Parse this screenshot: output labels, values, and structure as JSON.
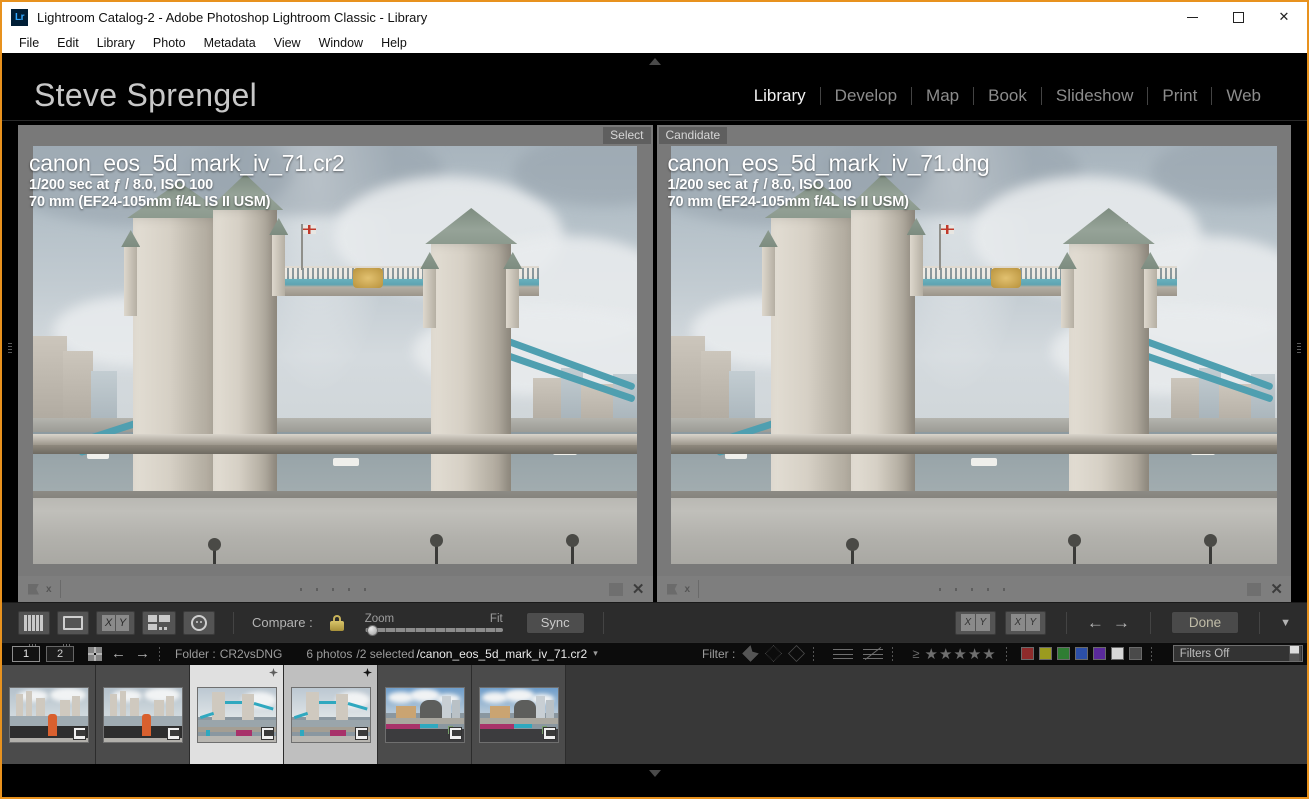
{
  "window": {
    "title": "Lightroom Catalog-2 - Adobe Photoshop Lightroom Classic - Library",
    "logo_text": "Lr",
    "minimize": "—",
    "maximize": "□",
    "close": "✕"
  },
  "menubar": {
    "items": [
      "File",
      "Edit",
      "Library",
      "Photo",
      "Metadata",
      "View",
      "Window",
      "Help"
    ]
  },
  "identity": {
    "name": "Steve Sprengel"
  },
  "modules": [
    {
      "label": "Library",
      "active": true
    },
    {
      "label": "Develop",
      "active": false
    },
    {
      "label": "Map",
      "active": false
    },
    {
      "label": "Book",
      "active": false
    },
    {
      "label": "Slideshow",
      "active": false
    },
    {
      "label": "Print",
      "active": false
    },
    {
      "label": "Web",
      "active": false
    }
  ],
  "compare": {
    "select": {
      "badge": "Select",
      "filename": "canon_eos_5d_mark_iv_71.cr2",
      "exposure": "1/200 sec at ƒ / 8.0, ISO 100",
      "lens": "70 mm (EF24-105mm f/4L IS II USM)"
    },
    "candidate": {
      "badge": "Candidate",
      "filename": "canon_eos_5d_mark_iv_71.dng",
      "exposure": "1/200 sec at ƒ / 8.0, ISO 100",
      "lens": "70 mm (EF24-105mm f/4L IS II USM)"
    }
  },
  "toolbar": {
    "view_buttons": [
      {
        "name": "grid-view",
        "glyph": "grid"
      },
      {
        "name": "loupe-view",
        "glyph": "loupe"
      },
      {
        "name": "compare-view",
        "glyph": "xy"
      },
      {
        "name": "survey-view",
        "glyph": "survey"
      },
      {
        "name": "people-view",
        "glyph": "face"
      }
    ],
    "compare_label": "Compare :",
    "lock_icon": "lock-icon",
    "zoom_label": "Zoom",
    "fit_label": "Fit",
    "sync_label": "Sync",
    "swap_label": "swap-select-candidate",
    "make_select_label": "make-select",
    "prev_label": "←",
    "next_label": "→",
    "done_label": "Done",
    "caret_label": "▼"
  },
  "filmstrip_header": {
    "screen1": "1",
    "screen2": "2",
    "folder_label": "Folder :",
    "folder_name": "CR2vsDNG",
    "photo_count": "6 photos",
    "selected_count": "/2 selected",
    "current_file": "/canon_eos_5d_mark_iv_71.cr2",
    "caret": "▾",
    "filter_label": "Filter :",
    "rating_prefix": "≥",
    "stars": [
      "★",
      "★",
      "★",
      "★",
      "★"
    ],
    "color_swatches": [
      "#8e2b2b",
      "#9b9b1f",
      "#2f7d33",
      "#2c4fa8",
      "#5a2a9b",
      "#d8d8d8",
      "#4a4a4a"
    ],
    "filters_select": "Filters Off"
  },
  "filmstrip": {
    "thumbs": [
      {
        "name": "thumb-1",
        "scene": "riverside",
        "selected": false,
        "mark": null
      },
      {
        "name": "thumb-2",
        "scene": "riverside",
        "selected": false,
        "mark": null
      },
      {
        "name": "thumb-3",
        "scene": "bridge",
        "selected": "primary",
        "mark": "hollow"
      },
      {
        "name": "thumb-4",
        "scene": "bridge",
        "selected": "secondary",
        "mark": "solid"
      },
      {
        "name": "thumb-5",
        "scene": "cityhall",
        "selected": false,
        "mark": null
      },
      {
        "name": "thumb-6",
        "scene": "cityhall",
        "selected": false,
        "mark": null
      }
    ]
  },
  "colors": {
    "window_border": "#e8921e",
    "app_background": "#000000",
    "panel_gray": "#797979",
    "toolbar_gray": "#2c2c2c",
    "filmstrip_gray": "#383838"
  }
}
